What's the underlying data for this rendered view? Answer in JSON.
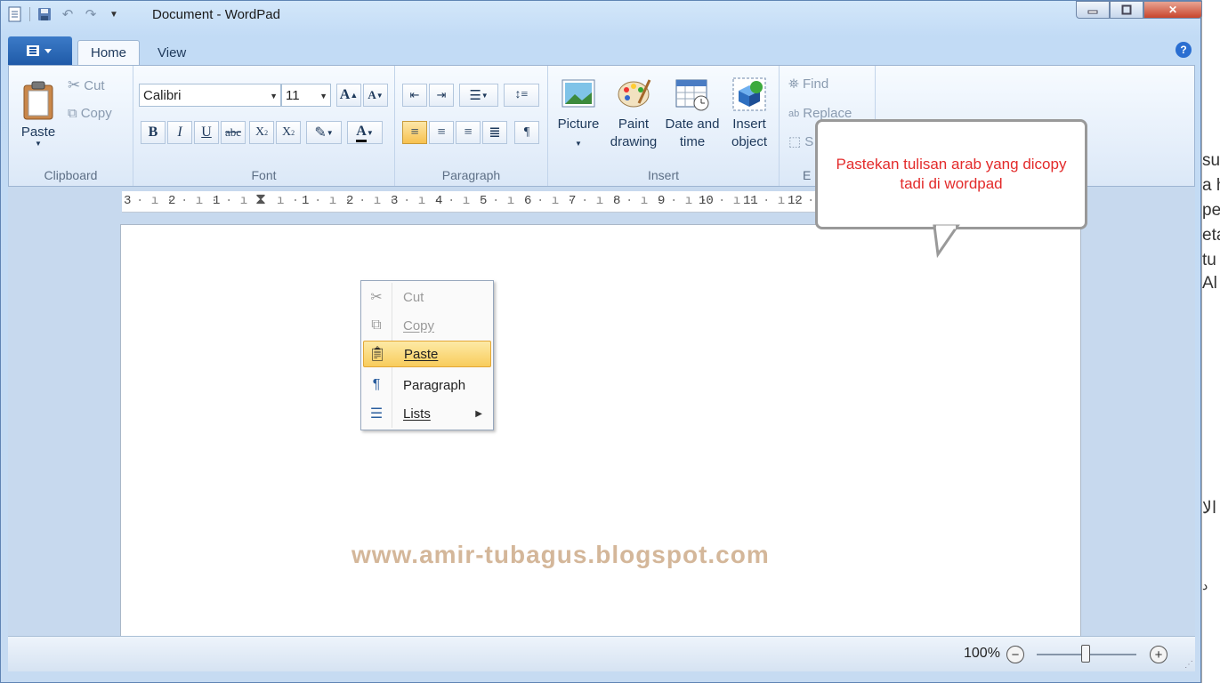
{
  "window": {
    "title": "Document - WordPad"
  },
  "tabs": [
    {
      "label": "Home"
    },
    {
      "label": "View"
    }
  ],
  "clipboard": {
    "paste": "Paste",
    "cut": "Cut",
    "copy": "Copy",
    "group": "Clipboard"
  },
  "font": {
    "family": "Calibri",
    "size": "11",
    "group": "Font"
  },
  "paragraph": {
    "group": "Paragraph"
  },
  "insert": {
    "picture": "Picture",
    "paint_line1": "Paint",
    "paint_line2": "drawing",
    "date_line1": "Date and",
    "date_line2": "time",
    "object_line1": "Insert",
    "object_line2": "object",
    "group": "Insert"
  },
  "editing": {
    "find": "Find",
    "replace": "Replace",
    "select_abbr": "S",
    "group_abbr": "E"
  },
  "ruler": [
    "3",
    "2",
    "1",
    "1",
    "2",
    "3",
    "4",
    "5",
    "6",
    "7",
    "8",
    "9",
    "10",
    "11",
    "12"
  ],
  "context_menu": {
    "items": [
      {
        "label": "Cut",
        "enabled": false
      },
      {
        "label": "Copy",
        "enabled": false
      },
      {
        "label": "Paste",
        "enabled": true,
        "highlighted": true
      },
      {
        "label": "Paragraph",
        "enabled": true
      },
      {
        "label": "Lists",
        "enabled": true,
        "submenu": true
      }
    ]
  },
  "callout": {
    "text": "Pastekan tulisan arab yang dicopy tadi di wordpad"
  },
  "watermark": "www.amir-tubagus.blogspot.com",
  "statusbar": {
    "zoom": "100%",
    "zoom_level_percent": 100
  },
  "background_window_fragments": [
    "sul",
    "a h",
    "pe",
    "eta",
    "tu",
    "Al",
    "الا",
    "د"
  ],
  "colors": {
    "callout_text": "#e32b2b",
    "watermark": "#d4b79a",
    "highlight": "#f8cc5c",
    "app_button": "#1f5aa8"
  }
}
